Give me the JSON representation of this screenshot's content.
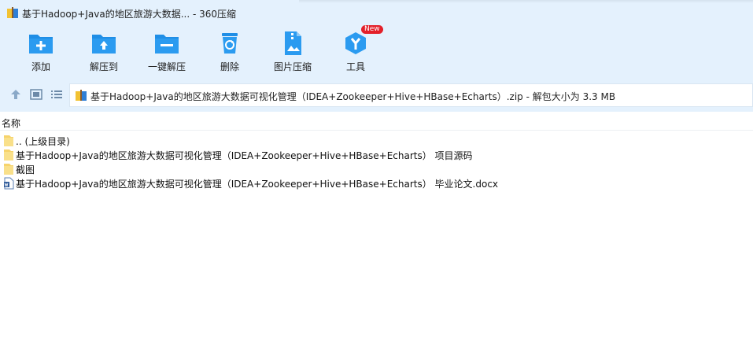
{
  "window": {
    "title": "基于Hadoop+Java的地区旅游大数据... - 360压缩"
  },
  "toolbar": {
    "items": [
      {
        "label": "添加",
        "icon": "add-folder-icon"
      },
      {
        "label": "解压到",
        "icon": "extract-to-icon"
      },
      {
        "label": "一键解压",
        "icon": "one-click-extract-icon"
      },
      {
        "label": "删除",
        "icon": "recycle-bin-icon"
      },
      {
        "label": "图片压缩",
        "icon": "image-compress-icon"
      },
      {
        "label": "工具",
        "icon": "tools-icon",
        "badge": "New"
      }
    ]
  },
  "address": {
    "path": "基于Hadoop+Java的地区旅游大数据可视化管理（IDEA+Zookeeper+Hive+HBase+Echarts）.zip - 解包大小为 3.3 MB"
  },
  "list": {
    "header_name": "名称",
    "rows": [
      {
        "name": ".. (上级目录)",
        "icon": "folder-icon"
      },
      {
        "name": "基于Hadoop+Java的地区旅游大数据可视化管理（IDEA+Zookeeper+Hive+HBase+Echarts） 项目源码",
        "icon": "folder-icon"
      },
      {
        "name": "截图",
        "icon": "folder-icon"
      },
      {
        "name": "基于Hadoop+Java的地区旅游大数据可视化管理（IDEA+Zookeeper+Hive+HBase+Echarts） 毕业论文.docx",
        "icon": "word-doc-icon"
      }
    ]
  },
  "colors": {
    "chrome_bg": "#e4f1fd",
    "icon_blue": "#1f8ee6",
    "folder_yellow": "#f6d36b",
    "badge_red": "#e3202a"
  }
}
